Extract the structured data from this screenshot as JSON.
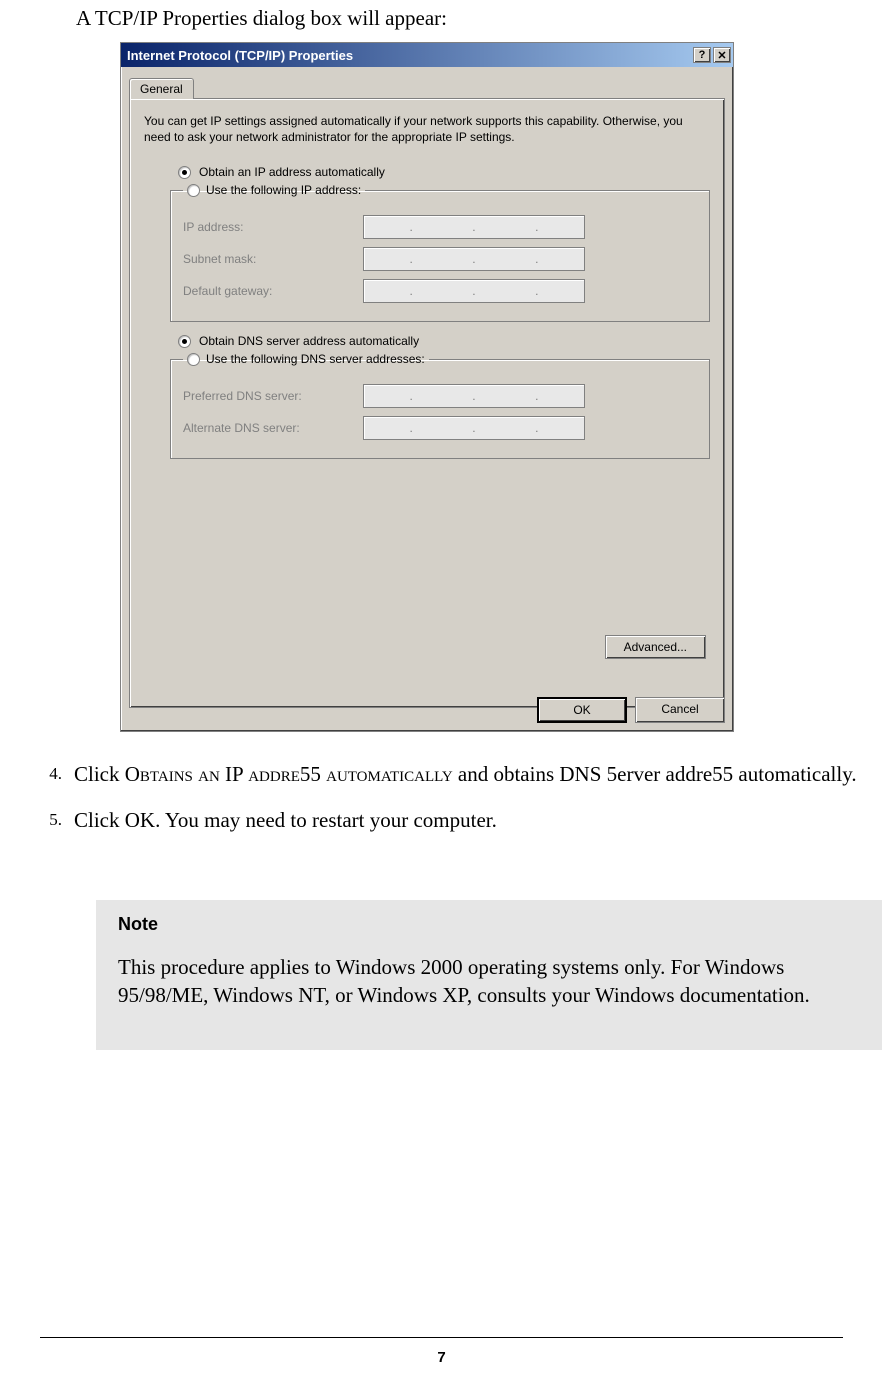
{
  "intro": "A TCP/IP Properties dialog box will appear:",
  "dialog": {
    "title": "Internet Protocol (TCP/IP) Properties",
    "help_btn": "?",
    "close_btn": "✕",
    "tab_general": "General",
    "description": "You can get IP settings assigned automatically if your network supports this capability. Otherwise, you need to ask your network administrator for the appropriate IP settings.",
    "ip_auto": "Obtain an IP address automatically",
    "ip_manual": "Use the following IP address:",
    "fields": {
      "ip": "IP address:",
      "subnet": "Subnet mask:",
      "gateway": "Default gateway:"
    },
    "dns_auto": "Obtain DNS server address automatically",
    "dns_manual": "Use the following DNS server addresses:",
    "dns_fields": {
      "pref": "Preferred DNS server:",
      "alt": "Alternate DNS server:"
    },
    "advanced": "Advanced...",
    "ok": "OK",
    "cancel": "Cancel"
  },
  "steps": {
    "s4_num": "4.",
    "s4_a": "Click ",
    "s4_b": "Obtains an IP addre55 automatically ",
    "s4_c": "and obtains DNS 5erver addre55 automatically.",
    "s5_num": "5.",
    "s5_a": "Click ",
    "s5_b": "OK",
    "s5_c": ". You may need to restart your computer."
  },
  "note": {
    "title": "Note",
    "body": "This procedure applies to Windows 2000 operating systems only. For Windows 95/98/ME, Windows NT, or Windows XP, consults your Windows documentation."
  },
  "page_number": "7"
}
